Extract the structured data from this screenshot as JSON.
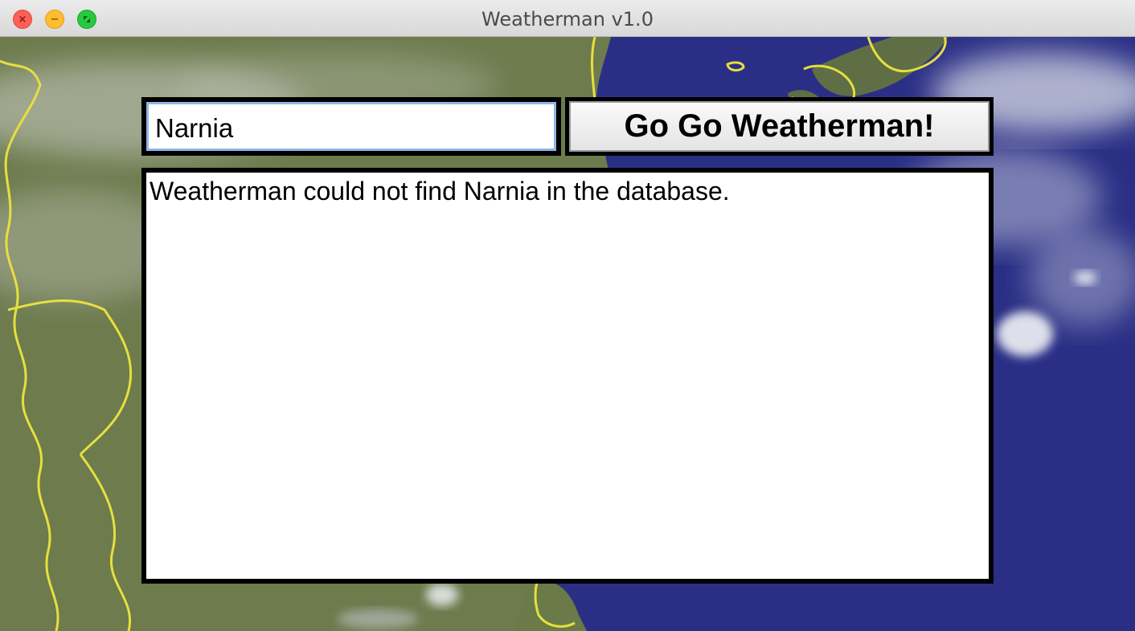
{
  "window": {
    "title": "Weatherman v1.0"
  },
  "search": {
    "value": "Narnia"
  },
  "actions": {
    "go_label": "Go Go Weatherman!"
  },
  "output": {
    "message": "Weatherman could not find Narnia in the database."
  },
  "icons": {
    "close": "close-icon",
    "minimize": "minimize-icon",
    "zoom": "fullscreen-icon"
  },
  "colors": {
    "ocean": "#2a2f85",
    "land": "#6b7a4a",
    "borders": "#e8e04a",
    "clouds": "#d8dbe0",
    "input_focus": "#8fb7e6"
  }
}
